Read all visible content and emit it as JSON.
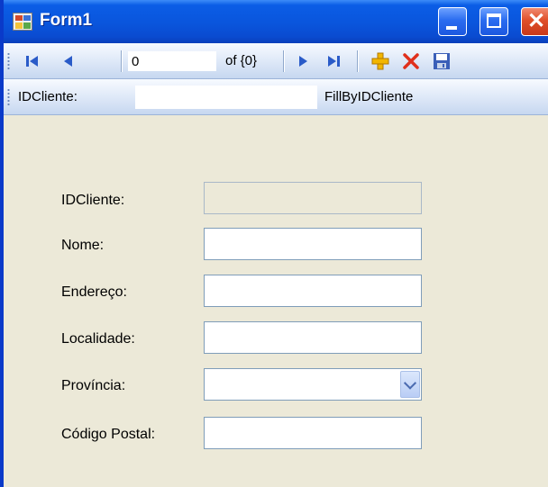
{
  "window": {
    "title": "Form1"
  },
  "navigator": {
    "position_value": "0",
    "count_label": "of {0}",
    "icons": [
      "move-first-icon",
      "move-previous-icon",
      "move-next-icon",
      "move-last-icon",
      "add-new-icon",
      "delete-icon",
      "save-icon"
    ]
  },
  "query": {
    "label": "IDCliente:",
    "value": "",
    "button_label": "FillByIDCliente"
  },
  "form": {
    "fields": [
      {
        "label": "IDCliente:",
        "value": ""
      },
      {
        "label": "Nome:",
        "value": ""
      },
      {
        "label": "Endereço:",
        "value": ""
      },
      {
        "label": "Localidade:",
        "value": ""
      },
      {
        "label": "Província:",
        "value": ""
      },
      {
        "label": "Código Postal:",
        "value": ""
      }
    ]
  },
  "colors": {
    "titlebar": "#0a55dc",
    "form_background": "#ece9d8",
    "add_icon": "#f2b600",
    "delete_icon": "#e0301c"
  }
}
